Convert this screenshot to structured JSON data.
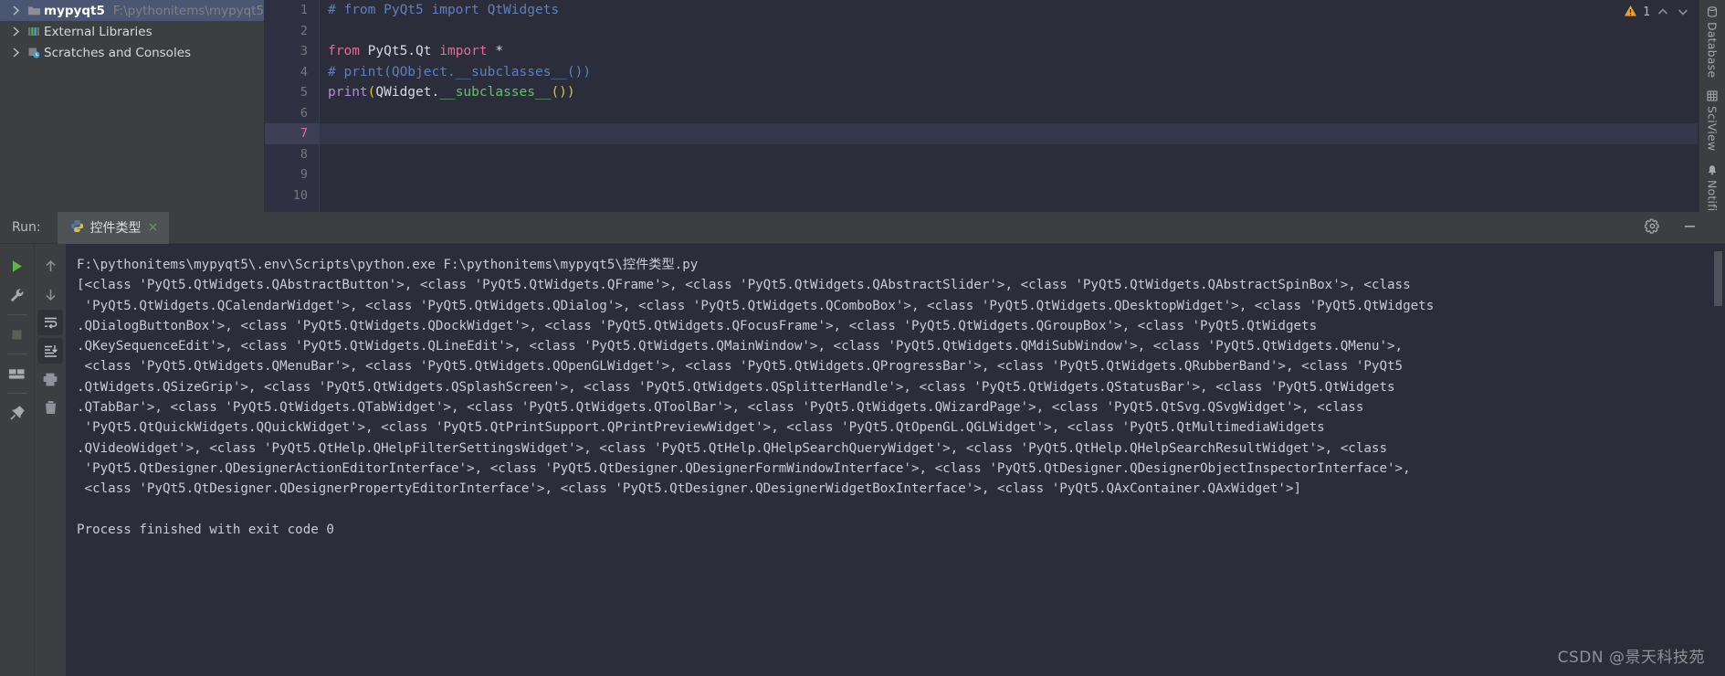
{
  "project_tree": {
    "items": [
      {
        "label": "mypyqt5",
        "path": "F:\\pythonitems\\mypyqt5",
        "icon": "folder-icon",
        "selected": true,
        "bold": true
      },
      {
        "label": "External Libraries",
        "path": "",
        "icon": "library-icon",
        "selected": false,
        "bold": false
      },
      {
        "label": "Scratches and Consoles",
        "path": "",
        "icon": "scratches-icon",
        "selected": false,
        "bold": false
      }
    ]
  },
  "editor": {
    "current_line": 7,
    "warning_count": "1",
    "gutter_lines": [
      "1",
      "2",
      "3",
      "4",
      "5",
      "6",
      "7",
      "8",
      "9",
      "10"
    ],
    "lines": [
      {
        "n": 1,
        "tokens": [
          {
            "t": "# from PyQt5 import QtWidgets",
            "c": "tok-comment"
          }
        ]
      },
      {
        "n": 2,
        "tokens": [
          {
            "t": "",
            "c": "tok-plain"
          }
        ]
      },
      {
        "n": 3,
        "tokens": [
          {
            "t": "from",
            "c": "tok-kw"
          },
          {
            "t": " PyQt5.Qt ",
            "c": "tok-plain"
          },
          {
            "t": "import",
            "c": "tok-kw"
          },
          {
            "t": " ",
            "c": "tok-plain"
          },
          {
            "t": "*",
            "c": "tok-star"
          }
        ]
      },
      {
        "n": 4,
        "tokens": [
          {
            "t": "# print(QObject.__subclasses__())",
            "c": "tok-comment"
          }
        ]
      },
      {
        "n": 5,
        "tokens": [
          {
            "t": "print",
            "c": "tok-fn"
          },
          {
            "t": "(",
            "c": "tok-paren"
          },
          {
            "t": "QWidget.",
            "c": "tok-plain"
          },
          {
            "t": "__subclasses__",
            "c": "tok-green"
          },
          {
            "t": "()",
            "c": "tok-paren"
          },
          {
            "t": ")",
            "c": "tok-paren"
          }
        ]
      },
      {
        "n": 6,
        "tokens": [
          {
            "t": "",
            "c": "tok-plain"
          }
        ]
      },
      {
        "n": 7,
        "tokens": [
          {
            "t": "",
            "c": "tok-plain"
          }
        ]
      },
      {
        "n": 8,
        "tokens": [
          {
            "t": "",
            "c": "tok-plain"
          }
        ]
      },
      {
        "n": 9,
        "tokens": [
          {
            "t": "",
            "c": "tok-plain"
          }
        ]
      },
      {
        "n": 10,
        "tokens": [
          {
            "t": "",
            "c": "tok-plain"
          }
        ]
      }
    ]
  },
  "right_rail": {
    "tabs": [
      {
        "label": "Database",
        "icon": "database-icon"
      },
      {
        "label": "SciView",
        "icon": "grid-icon"
      },
      {
        "label": "Notifications",
        "icon": "bell-icon"
      }
    ]
  },
  "run_panel": {
    "label": "Run:",
    "tab": {
      "title": "控件类型",
      "icon": "python-icon",
      "close": "×"
    },
    "header_actions": [
      {
        "name": "settings-button",
        "icon": "gear-icon"
      },
      {
        "name": "hide-button",
        "icon": "minimize-icon"
      }
    ],
    "toolbar_left": [
      {
        "name": "rerun-button",
        "icon": "play-icon"
      },
      {
        "name": "edit-configuration-button",
        "icon": "wrench-icon"
      },
      {
        "name": "stop-button",
        "icon": "stop-icon"
      },
      {
        "name": "restore-layout-button",
        "icon": "layout-icon"
      },
      {
        "name": "pin-tab-button",
        "icon": "pin-icon"
      }
    ],
    "toolbar_right": [
      {
        "name": "previous-occurrence-button",
        "icon": "arrow-up-icon"
      },
      {
        "name": "next-occurrence-button",
        "icon": "arrow-down-icon"
      },
      {
        "name": "soft-wrap-button",
        "icon": "wrap-icon"
      },
      {
        "name": "scroll-to-end-button",
        "icon": "scroll-end-icon"
      },
      {
        "name": "print-button",
        "icon": "print-icon"
      },
      {
        "name": "clear-all-button",
        "icon": "trash-icon"
      }
    ],
    "console_lines": [
      "F:\\pythonitems\\mypyqt5\\.env\\Scripts\\python.exe F:\\pythonitems\\mypyqt5\\控件类型.py",
      "[<class 'PyQt5.QtWidgets.QAbstractButton'>, <class 'PyQt5.QtWidgets.QFrame'>, <class 'PyQt5.QtWidgets.QAbstractSlider'>, <class 'PyQt5.QtWidgets.QAbstractSpinBox'>, <class",
      " 'PyQt5.QtWidgets.QCalendarWidget'>, <class 'PyQt5.QtWidgets.QDialog'>, <class 'PyQt5.QtWidgets.QComboBox'>, <class 'PyQt5.QtWidgets.QDesktopWidget'>, <class 'PyQt5.QtWidgets",
      ".QDialogButtonBox'>, <class 'PyQt5.QtWidgets.QDockWidget'>, <class 'PyQt5.QtWidgets.QFocusFrame'>, <class 'PyQt5.QtWidgets.QGroupBox'>, <class 'PyQt5.QtWidgets",
      ".QKeySequenceEdit'>, <class 'PyQt5.QtWidgets.QLineEdit'>, <class 'PyQt5.QtWidgets.QMainWindow'>, <class 'PyQt5.QtWidgets.QMdiSubWindow'>, <class 'PyQt5.QtWidgets.QMenu'>,",
      " <class 'PyQt5.QtWidgets.QMenuBar'>, <class 'PyQt5.QtWidgets.QOpenGLWidget'>, <class 'PyQt5.QtWidgets.QProgressBar'>, <class 'PyQt5.QtWidgets.QRubberBand'>, <class 'PyQt5",
      ".QtWidgets.QSizeGrip'>, <class 'PyQt5.QtWidgets.QSplashScreen'>, <class 'PyQt5.QtWidgets.QSplitterHandle'>, <class 'PyQt5.QtWidgets.QStatusBar'>, <class 'PyQt5.QtWidgets",
      ".QTabBar'>, <class 'PyQt5.QtWidgets.QTabWidget'>, <class 'PyQt5.QtWidgets.QToolBar'>, <class 'PyQt5.QtWidgets.QWizardPage'>, <class 'PyQt5.QtSvg.QSvgWidget'>, <class",
      " 'PyQt5.QtQuickWidgets.QQuickWidget'>, <class 'PyQt5.QtPrintSupport.QPrintPreviewWidget'>, <class 'PyQt5.QtOpenGL.QGLWidget'>, <class 'PyQt5.QtMultimediaWidgets",
      ".QVideoWidget'>, <class 'PyQt5.QtHelp.QHelpFilterSettingsWidget'>, <class 'PyQt5.QtHelp.QHelpSearchQueryWidget'>, <class 'PyQt5.QtHelp.QHelpSearchResultWidget'>, <class",
      " 'PyQt5.QtDesigner.QDesignerActionEditorInterface'>, <class 'PyQt5.QtDesigner.QDesignerFormWindowInterface'>, <class 'PyQt5.QtDesigner.QDesignerObjectInspectorInterface'>,",
      " <class 'PyQt5.QtDesigner.QDesignerPropertyEditorInterface'>, <class 'PyQt5.QtDesigner.QDesignerWidgetBoxInterface'>, <class 'PyQt5.QAxContainer.QAxWidget'>]",
      "",
      "Process finished with exit code 0"
    ]
  },
  "watermark": "CSDN @景天科技苑",
  "colors": {
    "panel_bg": "#3c3f41",
    "editor_bg": "#2b2d3a",
    "selection": "#4b5772",
    "accent_warning": "#f0a030",
    "run_green": "#62b543"
  }
}
